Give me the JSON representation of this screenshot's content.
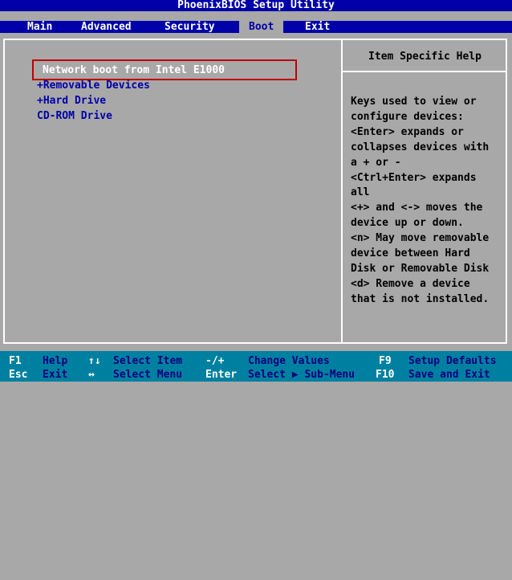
{
  "title": "PhoenixBIOS Setup Utility",
  "menu": [
    {
      "label": "Main",
      "active": false
    },
    {
      "label": "Advanced",
      "active": false
    },
    {
      "label": "Security",
      "active": false
    },
    {
      "label": "Boot",
      "active": true
    },
    {
      "label": "Exit",
      "active": false
    }
  ],
  "boot_order": [
    {
      "label": "Network boot from Intel E1000",
      "selected": true
    },
    {
      "label": "+Removable Devices",
      "selected": false
    },
    {
      "label": "+Hard Drive",
      "selected": false
    },
    {
      "label": " CD-ROM Drive",
      "selected": false
    }
  ],
  "help": {
    "title": "Item Specific Help",
    "lines": [
      "Keys used to view or",
      "configure devices:",
      "<Enter> expands or",
      "collapses devices with",
      "a + or -",
      "<Ctrl+Enter> expands",
      "all",
      "<+> and <-> moves the",
      "device up or down.",
      "<n> May move removable",
      "device between Hard",
      "Disk or Removable Disk",
      "<d> Remove a device",
      "that is not installed."
    ]
  },
  "footer": {
    "row1": [
      {
        "key": "F1",
        "desc": "Help"
      },
      {
        "key": "↑↓",
        "desc": "Select Item"
      },
      {
        "key": "-/+",
        "desc": "Change Values"
      },
      {
        "key": "F9",
        "desc": "Setup Defaults"
      }
    ],
    "row2": [
      {
        "key": "Esc",
        "desc": "Exit"
      },
      {
        "key": "↔",
        "desc": "Select Menu"
      },
      {
        "key": "Enter",
        "desc": "Select ▶ Sub-Menu"
      },
      {
        "key": "F10",
        "desc": "Save and Exit"
      }
    ]
  },
  "colors": {
    "bios_blue": "#0000a8",
    "bios_gray": "#a8a8a8",
    "footer_teal": "#0080a0",
    "highlight_red": "#c00000"
  }
}
